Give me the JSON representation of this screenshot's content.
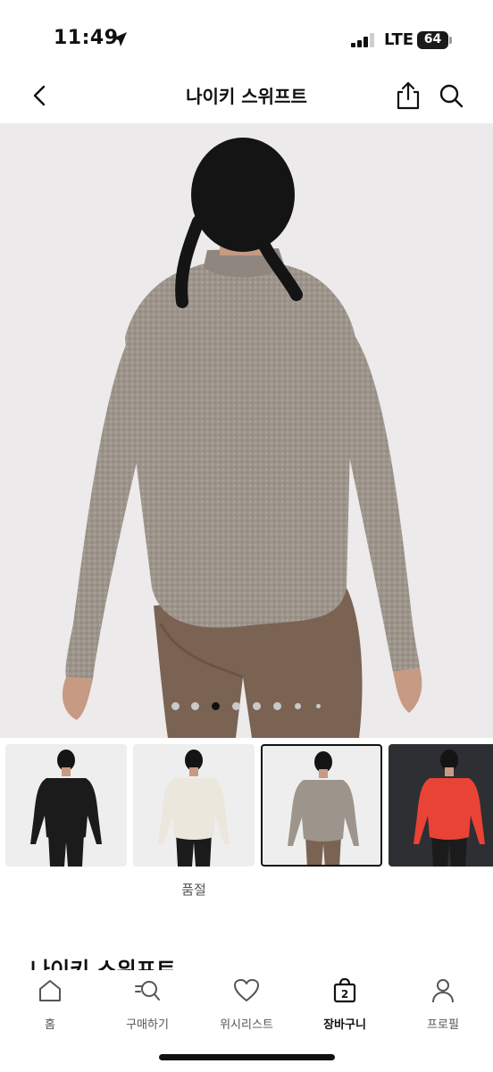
{
  "status_bar": {
    "time": "11:49",
    "network": "LTE",
    "battery": "64"
  },
  "header": {
    "title": "나이키 스위프트"
  },
  "gallery": {
    "dot_count": 8,
    "active_dot_index": 2,
    "background_color": "#eceaea"
  },
  "thumbnails": {
    "items": [
      {
        "color_name": "black",
        "top_color": "#1b1b1b",
        "bg": "#efeeee"
      },
      {
        "color_name": "sail",
        "top_color": "#ece7dc",
        "bg": "#efeeee"
      },
      {
        "color_name": "heather-grey",
        "top_color": "#9d948b",
        "bg": "#efeeee"
      },
      {
        "color_name": "red",
        "top_color": "#e94336",
        "bg": "#2d2f33"
      }
    ],
    "selected_index": 2,
    "soldout_label": "품절"
  },
  "product": {
    "name": "나이키 스위프트"
  },
  "tabbar": {
    "items": [
      {
        "label": "홈",
        "icon": "home-icon"
      },
      {
        "label": "구매하기",
        "icon": "shop-search-icon"
      },
      {
        "label": "위시리스트",
        "icon": "heart-icon"
      },
      {
        "label": "장바구니",
        "icon": "bag-icon",
        "badge": "2"
      },
      {
        "label": "프로필",
        "icon": "person-icon"
      }
    ],
    "active_index": 3
  },
  "colors": {
    "accent": "#111111",
    "muted": "#555555"
  }
}
